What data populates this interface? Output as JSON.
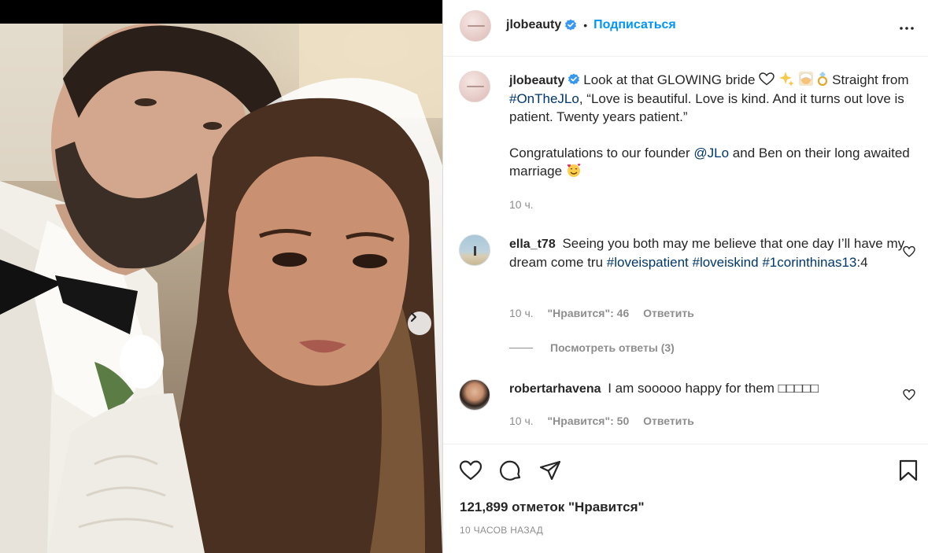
{
  "post": {
    "author": "jlobeauty",
    "follow_label": "Подписаться",
    "header_separator": "•",
    "caption_line1_pre": "Look at that GLOWING bride",
    "caption_line1_post": "Straight from",
    "caption_hashtag": "#OnTheJLo",
    "caption_quote": ", “Love is beautiful. Love is kind. And it turns out love is patient. Twenty years patient.”",
    "caption_para2_pre": "Congratulations to our founder",
    "caption_mention": "@JLo",
    "caption_para2_post": "and Ben on their long awaited marriage",
    "caption_time": "10 ч.",
    "likes_text": "121,899 отметок \"Нравится\"",
    "posted_ago": "10 ЧАСОВ НАЗАД"
  },
  "comments": [
    {
      "username": "ella_t78",
      "text_pre": "Seeing you both may me believe that one day I’ll have my dream come tru",
      "tag1": "#loveispatient",
      "tag2": "#loveiskind",
      "tag3": "#1corinthinas13",
      "text_post": ":4",
      "time": "10 ч.",
      "likes": "\"Нравится\": 46",
      "reply": "Ответить",
      "view_replies": "Посмотреть ответы (3)"
    },
    {
      "username": "robertarhavena",
      "text": "I am sooooo happy for them",
      "emoji_placeholder": "□□□□□",
      "time": "10 ч.",
      "likes": "\"Нравится\": 50",
      "reply": "Ответить"
    }
  ],
  "icons": {
    "like": "heart-icon",
    "comment": "comment-icon",
    "share": "send-icon",
    "save": "bookmark-icon",
    "more": "more-horizontal-icon",
    "carousel": "chevron-right-icon",
    "verified": "verified-badge-icon"
  },
  "colors": {
    "accent": "#0095f6",
    "verified": "#3897f0",
    "link": "#00376b",
    "muted": "#8e8e8e",
    "text": "#262626"
  }
}
